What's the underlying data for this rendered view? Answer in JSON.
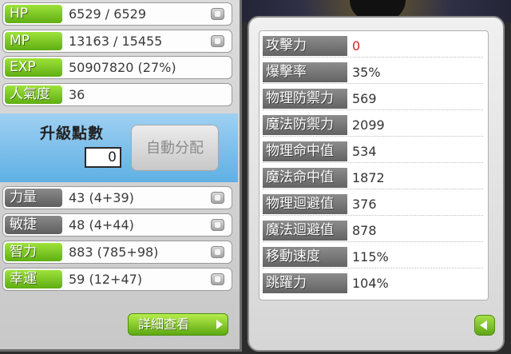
{
  "colors": {
    "green_label": "#7cc822",
    "gray_label": "#707070",
    "ap_blue": "#7ec0ec",
    "attack_value": "#e02020"
  },
  "vitals": [
    {
      "label": "HP",
      "value": "6529 / 6529",
      "style": "green"
    },
    {
      "label": "MP",
      "value": "13163 / 15455",
      "style": "green"
    },
    {
      "label": "EXP",
      "value": "50907820 (27%)",
      "style": "green"
    },
    {
      "label": "人氣度",
      "value": "36",
      "style": "green"
    }
  ],
  "ability_points": {
    "title": "升級點數",
    "value": "0",
    "auto_button": "自動分配"
  },
  "attributes": [
    {
      "label": "力量",
      "value": "43 (4+39)",
      "style": "gray"
    },
    {
      "label": "敏捷",
      "value": "48 (4+44)",
      "style": "gray"
    },
    {
      "label": "智力",
      "value": "883 (785+98)",
      "style": "green"
    },
    {
      "label": "幸運",
      "value": "59 (12+47)",
      "style": "green"
    }
  ],
  "detail_button": {
    "label": "詳細查看"
  },
  "detail_stats": [
    {
      "label": "攻擊力",
      "value": "0"
    },
    {
      "label": "爆擊率",
      "value": "35%"
    },
    {
      "label": "物理防禦力",
      "value": "569"
    },
    {
      "label": "魔法防禦力",
      "value": "2099"
    },
    {
      "label": "物理命中值",
      "value": "534"
    },
    {
      "label": "魔法命中值",
      "value": "1872"
    },
    {
      "label": "物理迴避值",
      "value": "376"
    },
    {
      "label": "魔法迴避值",
      "value": "878"
    },
    {
      "label": "移動速度",
      "value": "115%"
    },
    {
      "label": "跳躍力",
      "value": "104%"
    }
  ],
  "icons": {
    "increase": "plus-icon",
    "detail_arrow": "arrow-right-icon",
    "back": "arrow-left-icon"
  }
}
